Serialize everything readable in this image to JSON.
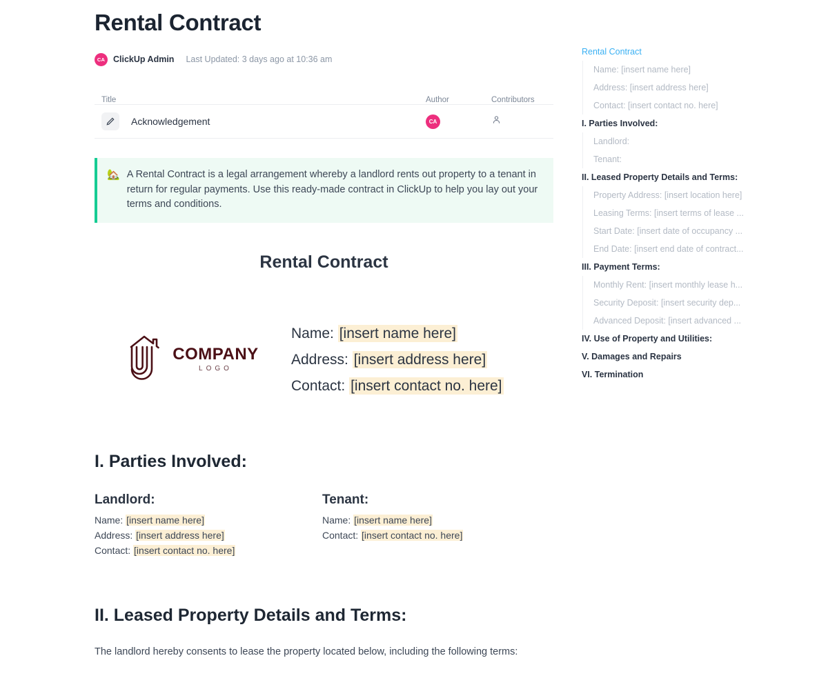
{
  "header": {
    "title": "Rental Contract",
    "author": "ClickUp Admin",
    "author_initials": "CA",
    "last_updated": "Last Updated: 3 days ago at 10:36 am"
  },
  "subpage_table": {
    "columns": [
      "Title",
      "Author",
      "Contributors"
    ],
    "rows": [
      {
        "icon": "pencil-icon",
        "title": "Acknowledgement",
        "author_initials": "CA",
        "contributors_icon": "person-icon"
      }
    ]
  },
  "callout": {
    "emoji": "🏡",
    "text": "A Rental Contract is a legal arrangement whereby a landlord rents out property to a tenant in return for regular payments. Use this ready-made contract in ClickUp to help you lay out your terms and conditions."
  },
  "document": {
    "center_title": "Rental Contract",
    "logo": {
      "company": "COMPANY",
      "sub": "LOGO"
    },
    "contact": {
      "name_label": "Name:",
      "name_value": "[insert name here]",
      "address_label": "Address:",
      "address_value": "[insert address here]",
      "contact_label": "Contact:",
      "contact_value": "[insert contact no. here]"
    },
    "section_1": {
      "heading": "I. Parties Involved:",
      "landlord": {
        "title": "Landlord:",
        "name_label": "Name:",
        "name_value": "[insert name here]",
        "address_label": "Address:",
        "address_value": "[insert address here]",
        "contact_label": "Contact:",
        "contact_value": "[insert contact no. here]"
      },
      "tenant": {
        "title": "Tenant:",
        "name_label": "Name:",
        "name_value": "[insert name here]",
        "contact_label": "Contact:",
        "contact_value": "[insert contact no. here]"
      }
    },
    "section_2": {
      "heading": "II. Leased Property Details and Terms:",
      "paragraph": "The landlord hereby consents to lease the property located below, including the following terms:"
    }
  },
  "outline": {
    "items": [
      {
        "label": "Rental Contract",
        "level": 0,
        "active": true
      },
      {
        "label": "Name: [insert name here]",
        "level": 1,
        "active": false
      },
      {
        "label": "Address: [insert address here]",
        "level": 1,
        "active": false
      },
      {
        "label": "Contact: [insert contact no. here]",
        "level": 1,
        "active": false
      },
      {
        "label": "I. Parties Involved:",
        "level": 0,
        "active": false
      },
      {
        "label": "Landlord:",
        "level": 1,
        "active": false
      },
      {
        "label": "Tenant:",
        "level": 1,
        "active": false
      },
      {
        "label": "II. Leased Property Details and Terms:",
        "level": 0,
        "active": false
      },
      {
        "label": "Property Address: [insert location here]",
        "level": 1,
        "active": false
      },
      {
        "label": "Leasing Terms: [insert terms of lease ...",
        "level": 1,
        "active": false
      },
      {
        "label": "Start Date: [insert date of occupancy ...",
        "level": 1,
        "active": false
      },
      {
        "label": "End Date: [insert end date of contract...",
        "level": 1,
        "active": false
      },
      {
        "label": "III. Payment Terms:",
        "level": 0,
        "active": false
      },
      {
        "label": "Monthly Rent: [insert monthly lease h...",
        "level": 1,
        "active": false
      },
      {
        "label": "Security Deposit: [insert security dep...",
        "level": 1,
        "active": false
      },
      {
        "label": "Advanced Deposit: [insert advanced ...",
        "level": 1,
        "active": false
      },
      {
        "label": "IV. Use of Property and Utilities:",
        "level": 0,
        "active": false
      },
      {
        "label": "V. Damages and Repairs",
        "level": 0,
        "active": false
      },
      {
        "label": "VI. Termination",
        "level": 0,
        "active": false
      }
    ]
  },
  "colors": {
    "accent_pink": "#ed2f7e",
    "callout_green": "#15cc93",
    "callout_bg": "#eefaf4",
    "highlight": "#fcefd4",
    "logo_maroon": "#4b1016",
    "outline_active": "#3ab0f3"
  }
}
